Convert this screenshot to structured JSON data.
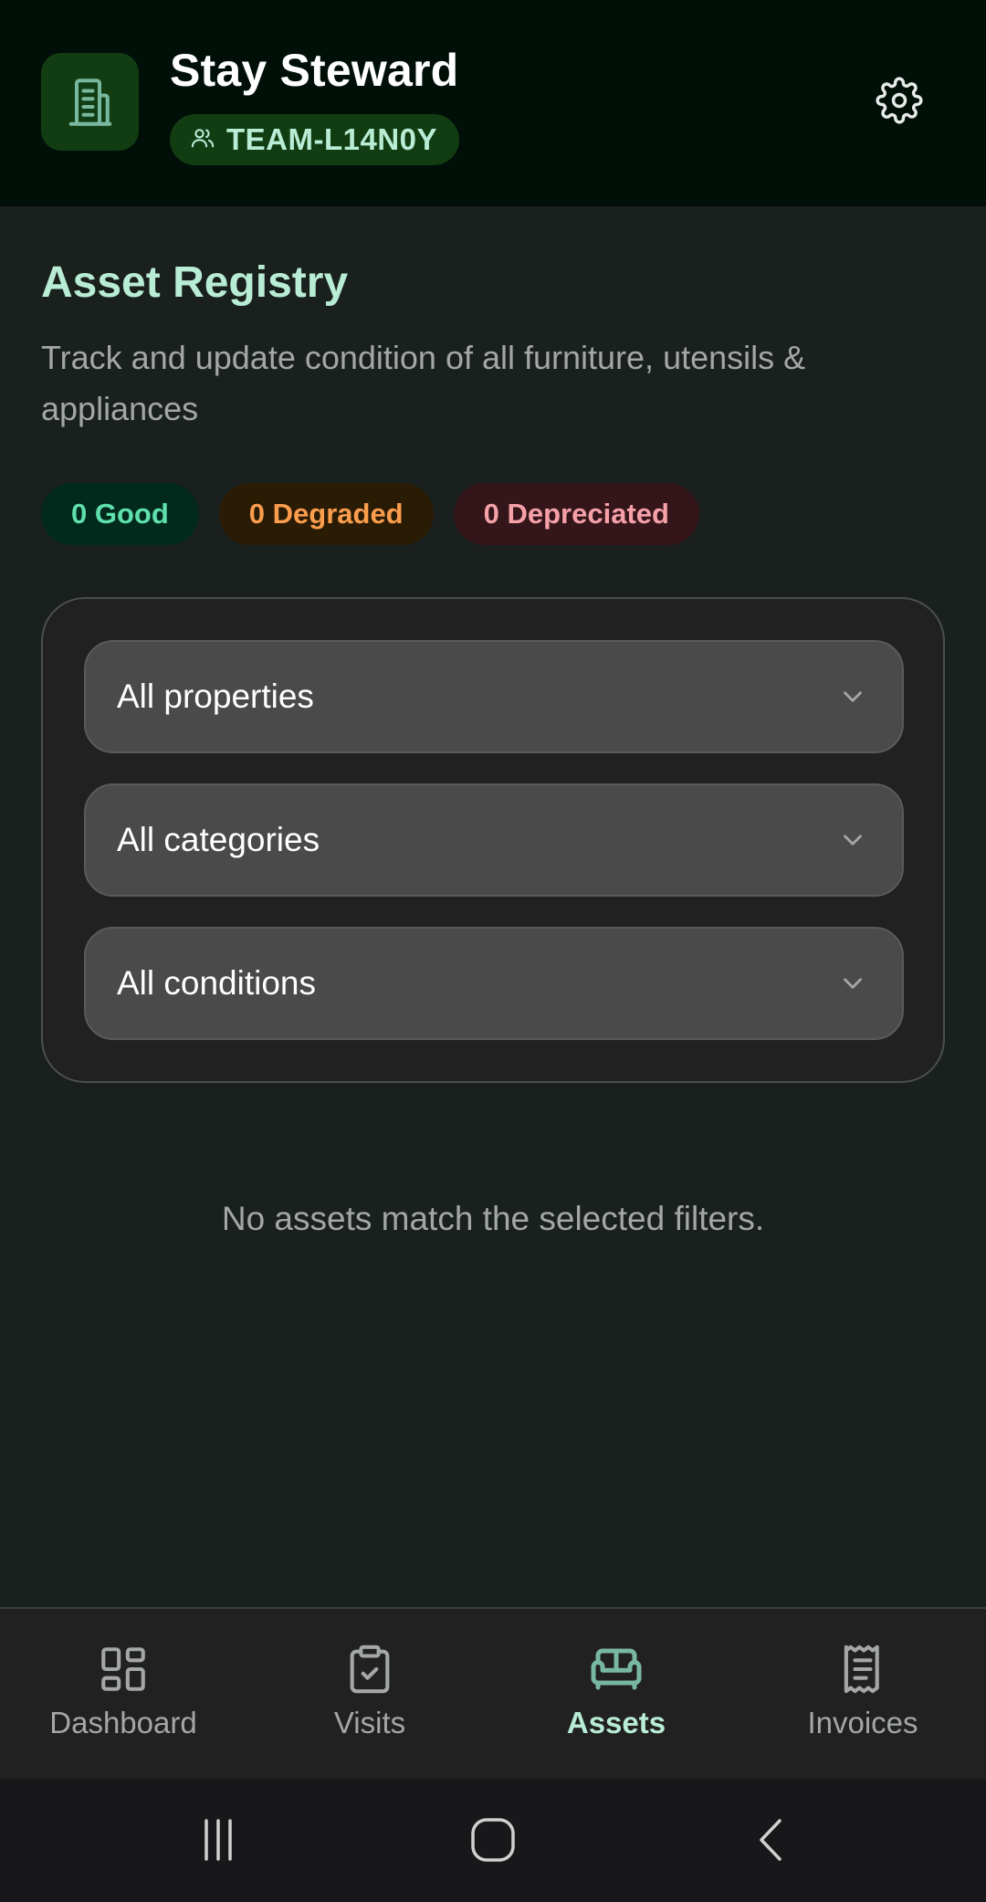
{
  "header": {
    "app_title": "Stay Steward",
    "team_code": "TEAM-L14N0Y",
    "logo_icon": "building-icon",
    "settings_icon": "gear-icon"
  },
  "page": {
    "title": "Asset Registry",
    "subtitle": "Track and update condition of all furniture, utensils & appliances"
  },
  "stats": {
    "good": "0 Good",
    "degraded": "0 Degraded",
    "depreciated": "0 Depreciated"
  },
  "filters": {
    "property": "All properties",
    "category": "All categories",
    "condition": "All conditions"
  },
  "empty_message": "No assets match the selected filters.",
  "bottom_nav": {
    "items": [
      {
        "label": "Dashboard",
        "icon": "grid-icon"
      },
      {
        "label": "Visits",
        "icon": "clipboard-check-icon"
      },
      {
        "label": "Assets",
        "icon": "sofa-icon",
        "active": true
      },
      {
        "label": "Invoices",
        "icon": "receipt-icon"
      }
    ]
  },
  "colors": {
    "accent": "#b8ecd5",
    "header_bg": "#000f08",
    "good": "#5fe0ad",
    "degraded": "#fb9d4c",
    "depreciated": "#f6a0a8"
  }
}
